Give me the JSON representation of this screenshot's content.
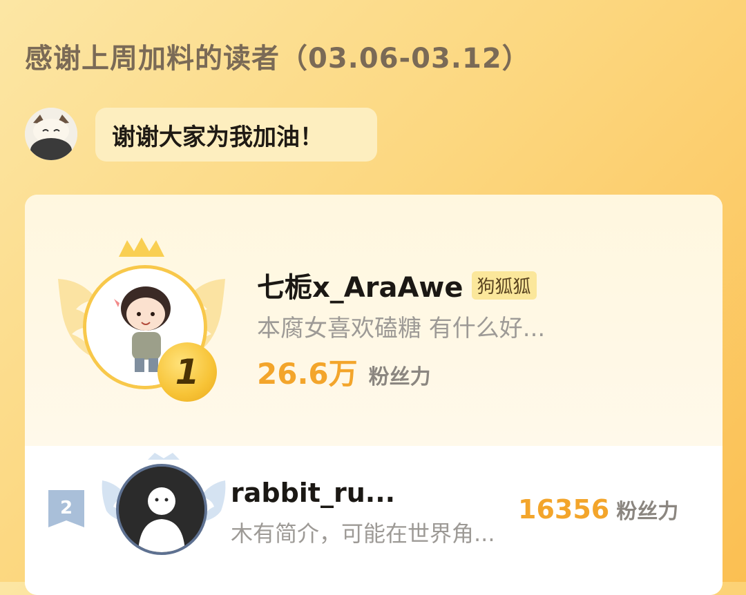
{
  "header": {
    "title": "感谢上周加料的读者（03.06-03.12）"
  },
  "author_message": {
    "text": "谢谢大家为我加油！"
  },
  "ranking": [
    {
      "rank": "1",
      "name": "七栀x_AraAwe",
      "tag": "狗狐狐",
      "bio": "本腐女喜欢磕糖 有什么好...",
      "score": "26.6万",
      "score_unit": "粉丝力"
    },
    {
      "rank": "2",
      "name": "rabbit_ru...",
      "bio": "木有简介，可能在世界角...",
      "score": "16356",
      "score_unit": "粉丝力"
    }
  ],
  "colors": {
    "accent": "#f3a52b",
    "gold": "#f7c336",
    "silver_blue": "#5e7191"
  }
}
